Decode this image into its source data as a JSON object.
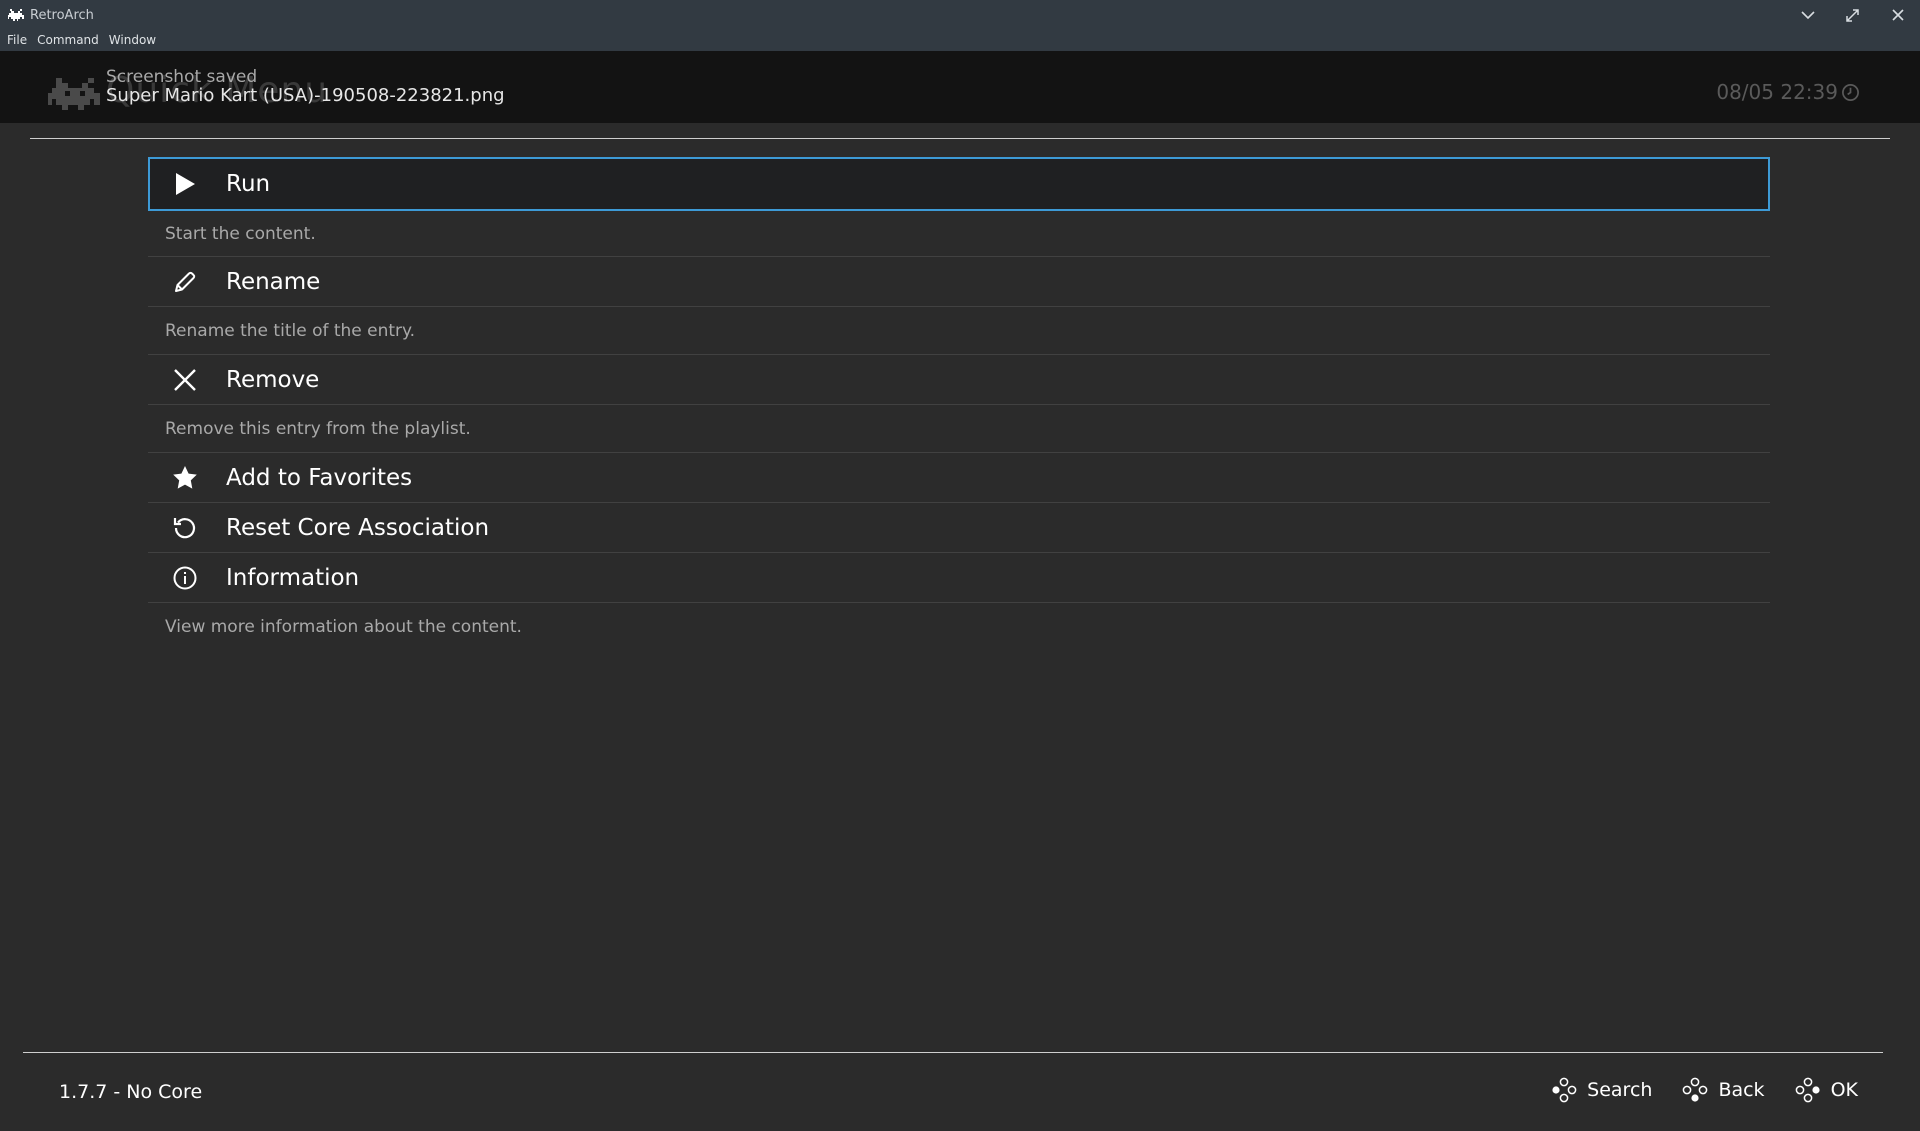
{
  "window": {
    "title": "RetroArch",
    "icon": "retroarch-invader-icon",
    "controls": [
      "minimize-icon",
      "maximize-icon",
      "close-icon"
    ]
  },
  "menubar": {
    "items": [
      "File",
      "Command",
      "Window"
    ]
  },
  "header": {
    "title": "Quick Menu",
    "notification": {
      "line1": "Screenshot saved",
      "line2": "Super Mario Kart (USA)-190508-223821.png"
    },
    "clock": "08/05 22:39",
    "clock_icon": "clock-icon"
  },
  "menu": {
    "entries": [
      {
        "label": "Run",
        "icon": "play-icon",
        "sublabel": "Start the content.",
        "selected": true
      },
      {
        "label": "Rename",
        "icon": "pencil-icon",
        "sublabel": "Rename the title of the entry."
      },
      {
        "label": "Remove",
        "icon": "close-x-icon",
        "sublabel": "Remove this entry from the playlist."
      },
      {
        "label": "Add to Favorites",
        "icon": "star-icon"
      },
      {
        "label": "Reset Core Association",
        "icon": "reset-icon"
      },
      {
        "label": "Information",
        "icon": "info-icon",
        "sublabel": "View more information about the content."
      }
    ]
  },
  "footer": {
    "version": "1.7.7 - No Core",
    "actions": [
      {
        "label": "Search",
        "icon": "gamepad-buttons-icon"
      },
      {
        "label": "Back",
        "icon": "gamepad-buttons-icon"
      },
      {
        "label": "OK",
        "icon": "gamepad-buttons-icon"
      }
    ]
  },
  "colors": {
    "background": "#2b2b2b",
    "header": "#131313",
    "titlebar": "#323a42",
    "selection_border": "#3d9ad6"
  }
}
